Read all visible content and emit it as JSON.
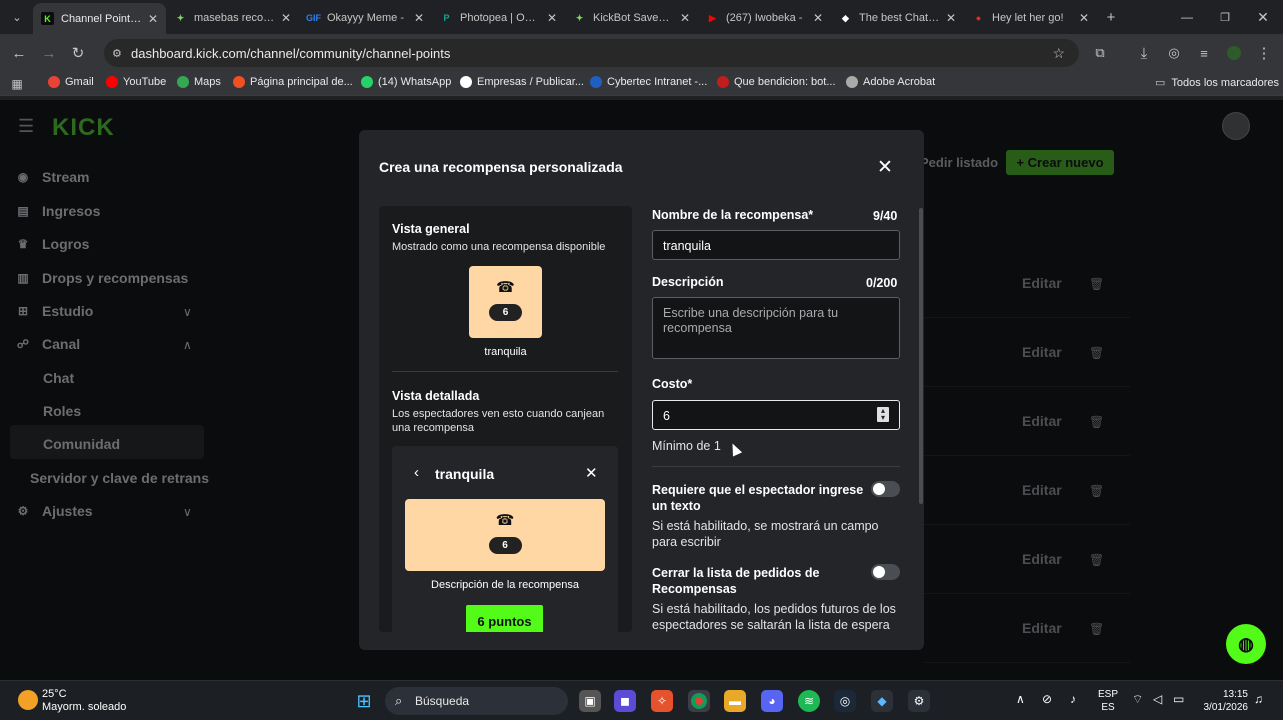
{
  "browser": {
    "tabs": [
      {
        "title": "Channel Points -",
        "favicon": "K",
        "color": "#53fc18",
        "active": true
      },
      {
        "title": "masebas recorta",
        "favicon": "✦",
        "color": "#7dd35c",
        "active": false
      },
      {
        "title": "Okayyy Meme -",
        "favicon": "GIF",
        "color": "#2f80ed",
        "active": false
      },
      {
        "title": "Photopea | Onlin",
        "favicon": "P",
        "color": "#18a497",
        "active": false
      },
      {
        "title": "KickBot Saved W",
        "favicon": "✦",
        "color": "#7dd35c",
        "active": false
      },
      {
        "title": "(267) Iwobeka -",
        "favicon": "▶",
        "color": "#ff0000",
        "active": false
      },
      {
        "title": "The best ChatBo",
        "favicon": "◆",
        "color": "#ffffff",
        "active": false
      },
      {
        "title": "Hey let her go!",
        "favicon": "●",
        "color": "#e32b2b",
        "active": false
      }
    ],
    "url": "dashboard.kick.com/channel/community/channel-points",
    "bookmarks": [
      {
        "label": "Gmail",
        "color": "#ea4335"
      },
      {
        "label": "YouTube",
        "color": "#ff0000"
      },
      {
        "label": "Maps",
        "color": "#34a853"
      },
      {
        "label": "Página principal de...",
        "color": "#f25022"
      },
      {
        "label": "(14) WhatsApp",
        "color": "#25d366"
      },
      {
        "label": "Empresas / Publicar...",
        "color": "#ffffff"
      },
      {
        "label": "Cybertec Intranet -...",
        "color": "#1f5fbf"
      },
      {
        "label": "Que bendicion: bot...",
        "color": "#c21d1d"
      },
      {
        "label": "Adobe Acrobat",
        "color": "#aaaaaa"
      }
    ],
    "all_bookmarks": "Todos los marcadores"
  },
  "sidebar": {
    "logo": "KICK",
    "items": [
      {
        "label": "Stream",
        "icon": "broadcast-icon"
      },
      {
        "label": "Ingresos",
        "icon": "wallet-icon"
      },
      {
        "label": "Logros",
        "icon": "trophy-icon"
      },
      {
        "label": "Drops y recompensas",
        "icon": "gift-icon"
      },
      {
        "label": "Estudio",
        "icon": "studio-icon"
      },
      {
        "label": "Canal",
        "icon": "people-icon"
      }
    ],
    "sub_items": [
      "Chat",
      "Roles",
      "Comunidad"
    ],
    "server_item": "Servidor y clave de retrans",
    "settings_item": "Ajustes"
  },
  "background": {
    "pedir_listado": "Pedir listado",
    "crear_nuevo": "+ Crear nuevo",
    "edit_label": "Editar",
    "row_count": 6
  },
  "modal": {
    "title": "Crea una recompensa personalizada",
    "overview": {
      "heading": "Vista general",
      "subtitle": "Mostrado como una recompensa disponible",
      "reward_name": "tranquila",
      "cost": "6"
    },
    "detailed": {
      "heading": "Vista detallada",
      "subtitle": "Los espectadores ven esto cuando canjean una recompensa",
      "title": "tranquila",
      "cost": "6",
      "description": "Descripción de la recompensa",
      "button": "6 puntos"
    },
    "form": {
      "name_label": "Nombre de la recompensa*",
      "name_counter": "9/40",
      "name_value": "tranquila",
      "desc_label": "Descripción",
      "desc_counter": "0/200",
      "desc_placeholder": "Escribe una descripción para tu recompensa",
      "cost_label": "Costo*",
      "cost_value": "6",
      "cost_hint": "Mínimo de 1",
      "toggle1_label": "Requiere que el espectador ingrese un texto",
      "toggle1_help": "Si está habilitado, se mostrará un campo para escribir",
      "toggle2_label": "Cerrar la lista de pedidos de Recompensas",
      "toggle2_help": "Si está habilitado, los pedidos futuros de los espectadores se saltarán la lista de espera"
    }
  },
  "taskbar": {
    "weather_temp": "25°C",
    "weather_desc": "Mayorm. soleado",
    "search_label": "Búsqueda",
    "lang1": "ESP",
    "lang2": "ES",
    "time": "13:15",
    "date": "3/01/2026"
  }
}
